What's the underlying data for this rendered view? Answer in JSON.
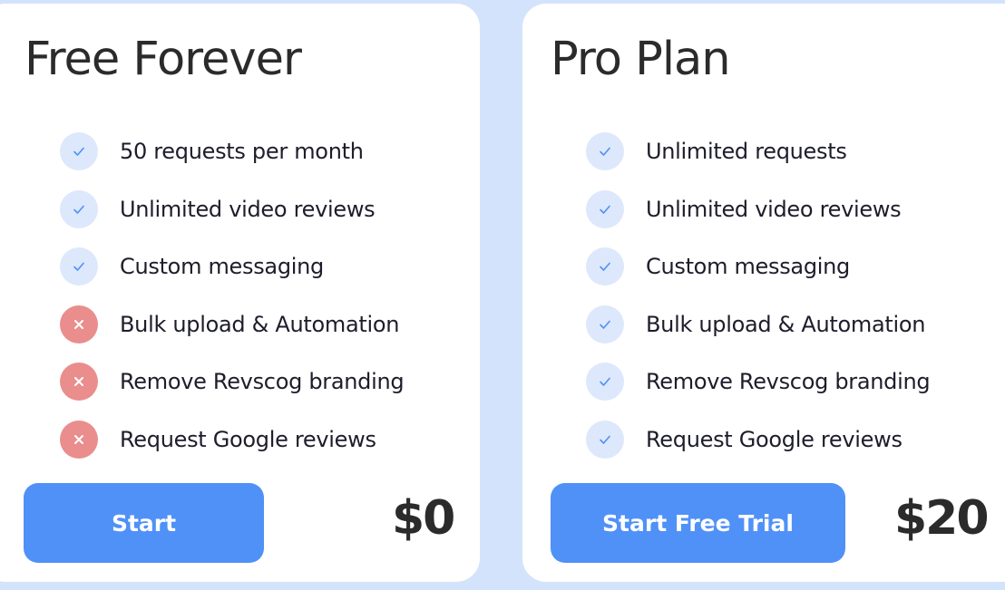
{
  "colors": {
    "background": "#d3e3fb",
    "card": "#ffffff",
    "accent": "#4f91f7",
    "check_bg": "#dde8fc",
    "check_mark": "#4f91f7",
    "cross_bg": "#ea8d8d"
  },
  "plans": [
    {
      "title": "Free Forever",
      "features": [
        {
          "label": "50 requests per month",
          "included": true,
          "icon": "check-icon"
        },
        {
          "label": "Unlimited video reviews",
          "included": true,
          "icon": "check-icon"
        },
        {
          "label": "Custom messaging",
          "included": true,
          "icon": "check-icon"
        },
        {
          "label": "Bulk upload & Automation",
          "included": false,
          "icon": "cross-icon"
        },
        {
          "label": "Remove Revscog branding",
          "included": false,
          "icon": "cross-icon"
        },
        {
          "label": "Request Google reviews",
          "included": false,
          "icon": "cross-icon"
        }
      ],
      "button_label": "Start",
      "price": "$0"
    },
    {
      "title": "Pro Plan",
      "features": [
        {
          "label": "Unlimited requests",
          "included": true,
          "icon": "check-icon"
        },
        {
          "label": "Unlimited video reviews",
          "included": true,
          "icon": "check-icon"
        },
        {
          "label": "Custom messaging",
          "included": true,
          "icon": "check-icon"
        },
        {
          "label": "Bulk upload & Automation",
          "included": true,
          "icon": "check-icon"
        },
        {
          "label": "Remove Revscog branding",
          "included": true,
          "icon": "check-icon"
        },
        {
          "label": "Request Google reviews",
          "included": true,
          "icon": "check-icon"
        }
      ],
      "button_label": "Start Free Trial",
      "price": "$20"
    }
  ]
}
